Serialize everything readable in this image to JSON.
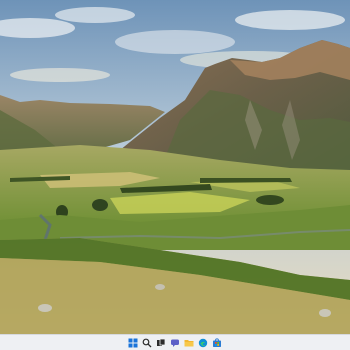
{
  "desktop": {
    "wallpaper_icon": "landscape-wallpaper"
  },
  "taskbar": {
    "items": [
      {
        "icon": "windows-start-icon",
        "color": "#1a73d9"
      },
      {
        "icon": "search-icon",
        "color": "#2b2b2b"
      },
      {
        "icon": "task-view-icon",
        "color": "#2b2b2b"
      },
      {
        "icon": "chat-icon",
        "color": "#5b5fc7"
      },
      {
        "icon": "file-explorer-icon",
        "color": "#f2b731"
      },
      {
        "icon": "edge-icon",
        "color": "#0f8fd6"
      },
      {
        "icon": "store-icon",
        "color": "#2b7cd3"
      }
    ]
  }
}
